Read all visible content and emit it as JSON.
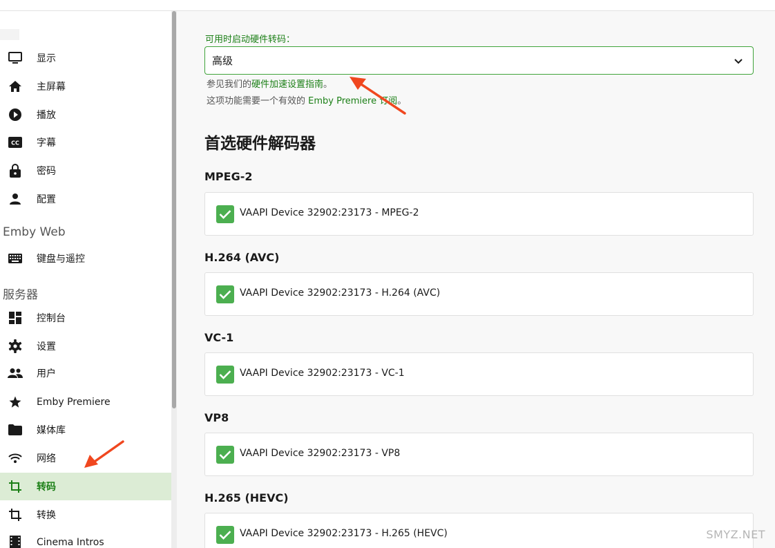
{
  "sidebar": {
    "items_top": [
      {
        "label": "显示",
        "icon": "monitor-icon"
      },
      {
        "label": "主屏幕",
        "icon": "home-icon"
      },
      {
        "label": "播放",
        "icon": "play-circle-icon"
      },
      {
        "label": "字幕",
        "icon": "closed-caption-icon"
      },
      {
        "label": "密码",
        "icon": "lock-icon"
      },
      {
        "label": "配置",
        "icon": "person-icon"
      }
    ],
    "section_web": "Emby Web",
    "items_web": [
      {
        "label": "键盘与遥控",
        "icon": "keyboard-icon"
      }
    ],
    "section_server": "服务器",
    "items_server": [
      {
        "label": "控制台",
        "icon": "dashboard-icon"
      },
      {
        "label": "设置",
        "icon": "gear-icon"
      },
      {
        "label": "用户",
        "icon": "people-icon"
      },
      {
        "label": "Emby Premiere",
        "icon": "star-icon"
      },
      {
        "label": "媒体库",
        "icon": "folder-icon"
      },
      {
        "label": "网络",
        "icon": "wifi-icon"
      },
      {
        "label": "转码",
        "icon": "crop-icon",
        "active": true
      },
      {
        "label": "转换",
        "icon": "crop-icon"
      },
      {
        "label": "Cinema Intros",
        "icon": "film-icon"
      }
    ]
  },
  "main": {
    "hw_label": "可用时启动硬件转码：",
    "hw_value": "高级",
    "hint1_prefix": "参见我们的",
    "hint1_link": "硬件加速设置指南",
    "hint1_suffix": "。",
    "hint2_prefix": "这项功能需要一个有效的 ",
    "hint2_link": "Emby Premiere 订阅",
    "hint2_suffix": "。",
    "heading": "首选硬件解码器",
    "codecs": [
      {
        "title": "MPEG-2",
        "device": "VAAPI Device 32902:23173 - MPEG-2",
        "checked": true
      },
      {
        "title": "H.264 (AVC)",
        "device": "VAAPI Device 32902:23173 - H.264 (AVC)",
        "checked": true
      },
      {
        "title": "VC-1",
        "device": "VAAPI Device 32902:23173 - VC-1",
        "checked": true
      },
      {
        "title": "VP8",
        "device": "VAAPI Device 32902:23173 - VP8",
        "checked": true
      },
      {
        "title": "H.265 (HEVC)",
        "device": "VAAPI Device 32902:23173 - H.265 (HEVC)",
        "checked": true
      }
    ]
  },
  "watermark": "SMYZ.NET",
  "colors": {
    "accent": "#1b7f16",
    "active_bg": "#dcecd5",
    "check": "#4caf50",
    "arrow": "#f0471f"
  }
}
